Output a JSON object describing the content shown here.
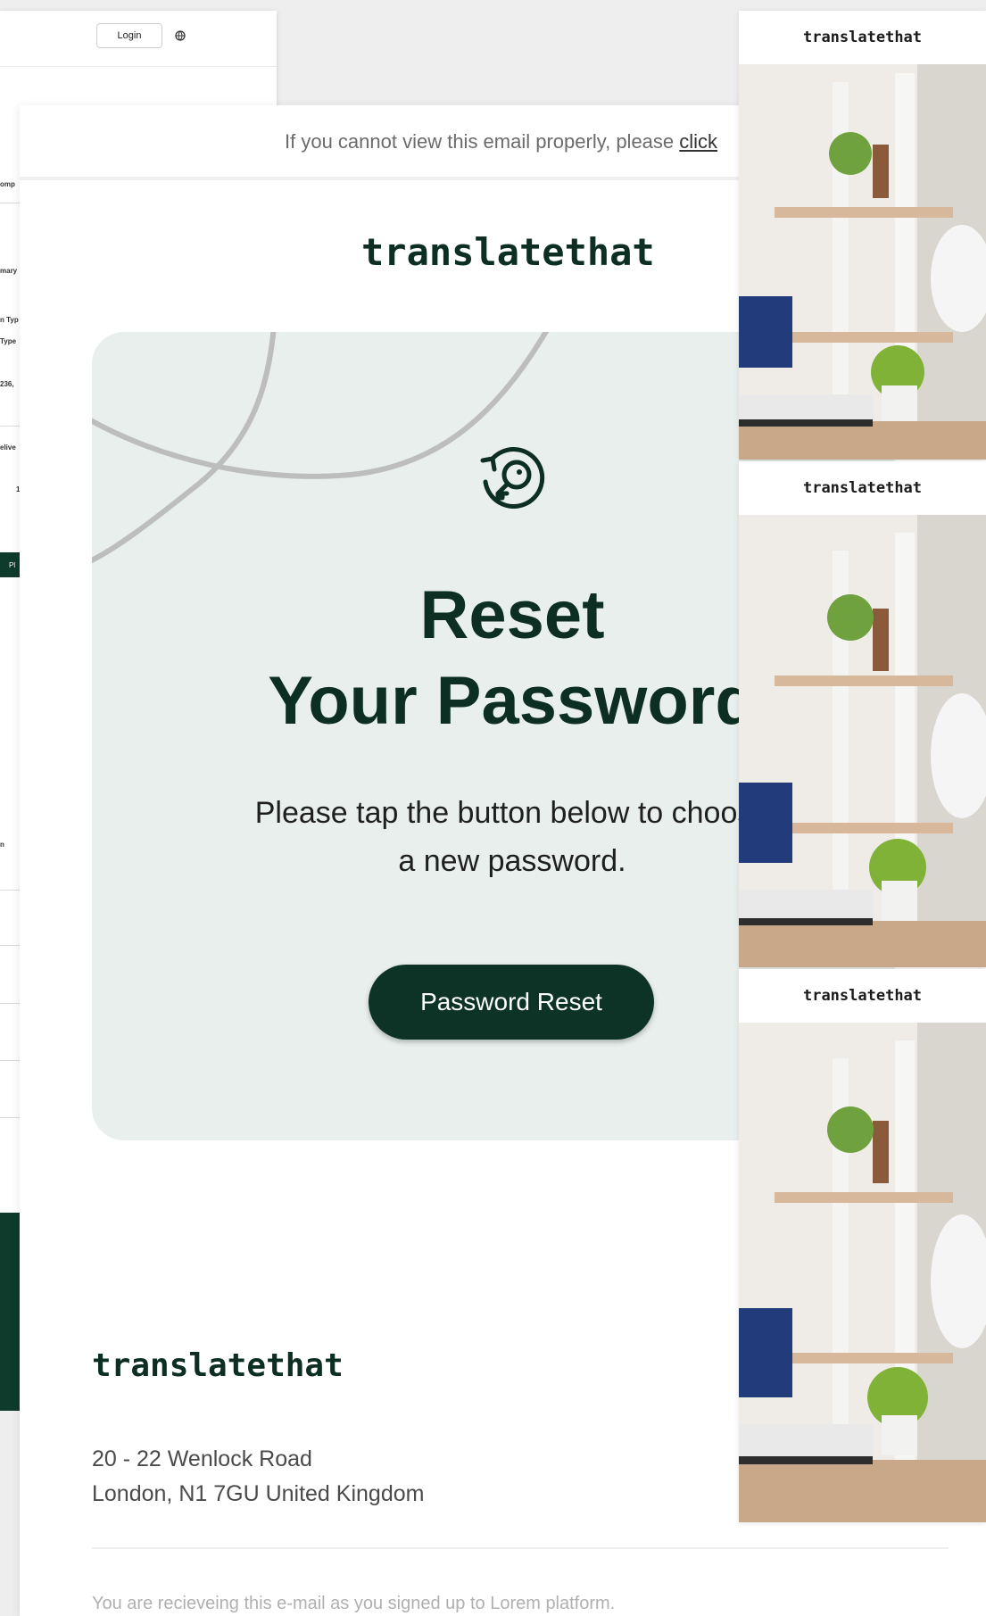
{
  "background_app": {
    "login_label": "Login",
    "fragments": [
      "omp",
      "mary",
      "n Typ",
      "Type",
      "236,",
      "elive",
      "1",
      "Pl",
      "n"
    ]
  },
  "email": {
    "top_notice": {
      "text": "If you cannot view this email properly, please ",
      "link": "click"
    },
    "brand": "translatethat",
    "hero": {
      "icon": "key-reset-icon",
      "title_line1": "Reset",
      "title_line2": "Your Password",
      "description_line1": "Please tap the button below to choose",
      "description_line2": "a new password.",
      "button_label": "Password Reset"
    },
    "footer": {
      "brand": "translatethat",
      "address_line1": "20 - 22 Wenlock Road",
      "address_line2": "London, N1 7GU United Kingdom",
      "note": "You are recieveing this e-mail as you signed up to Lorem platform."
    }
  },
  "previews": [
    {
      "brand": "translatethat"
    },
    {
      "brand": "translatethat"
    },
    {
      "brand": "translatethat"
    }
  ],
  "colors": {
    "brand_dark": "#0c3326",
    "hero_bg": "#e8efec",
    "arc": "#bdbdbd"
  }
}
